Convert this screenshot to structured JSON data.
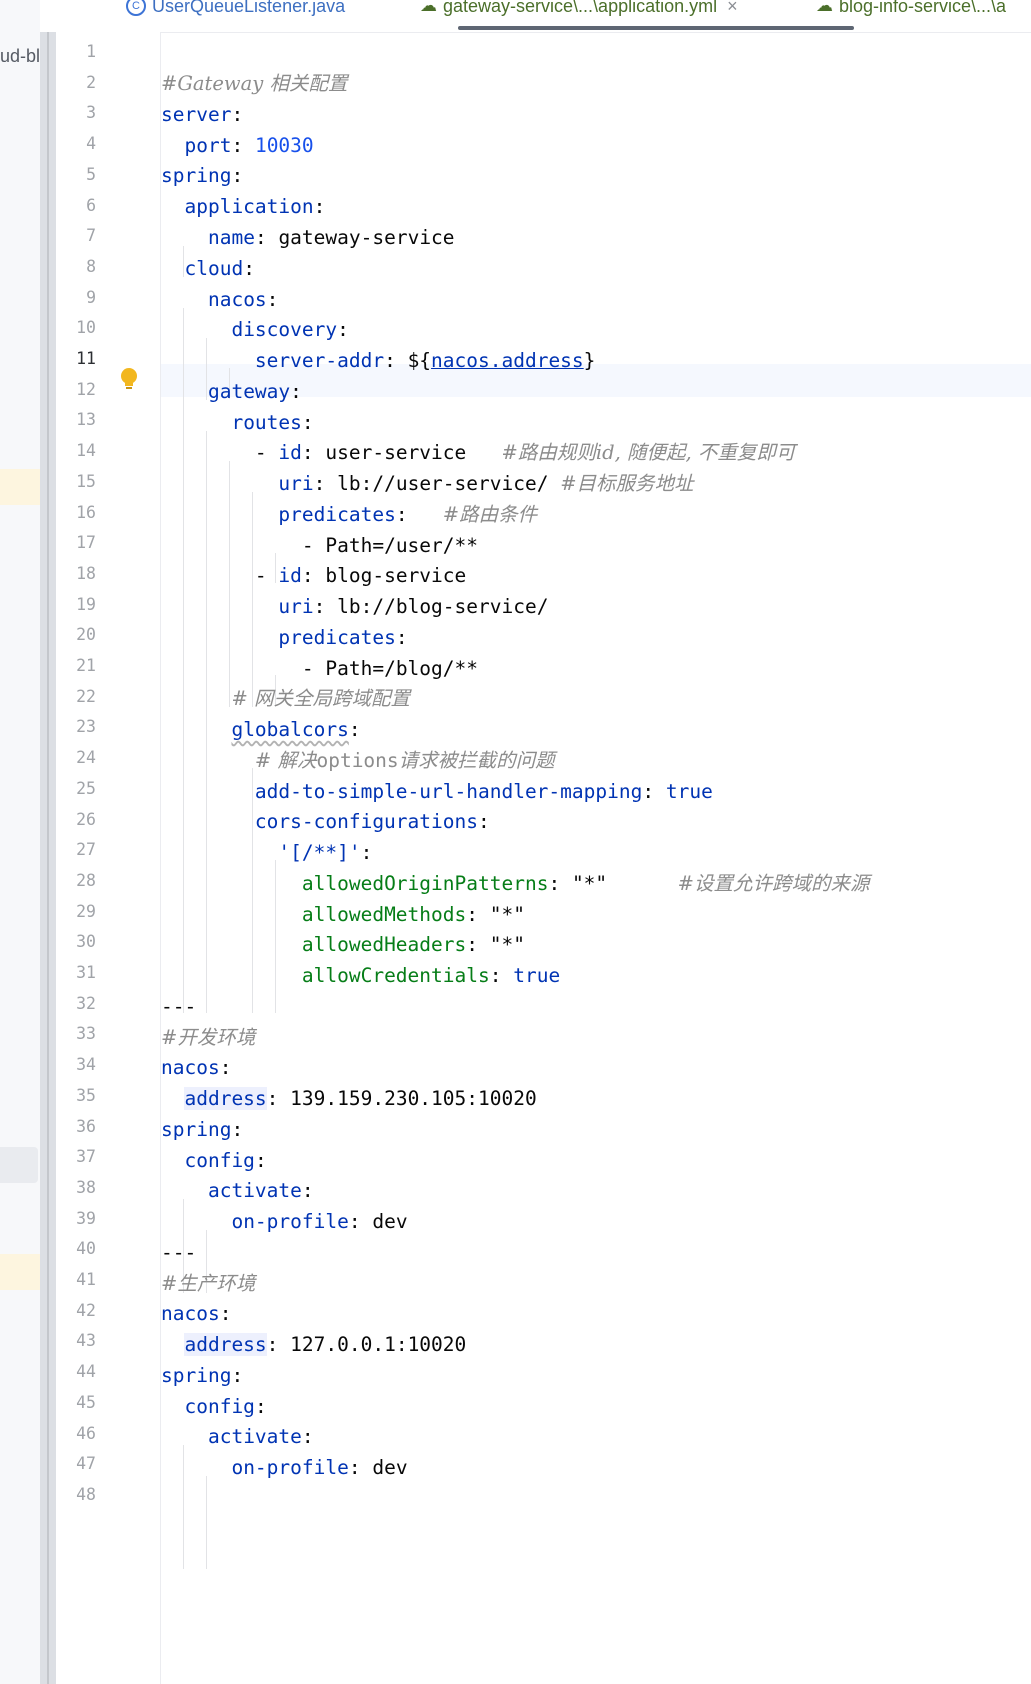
{
  "project": {
    "label": "ud-blo"
  },
  "tabs": [
    {
      "label": "UserQueueListener.java",
      "icon": "java-class-icon",
      "active": false
    },
    {
      "label": "gateway-service\\...\\application.yml",
      "icon": "yaml-file-icon",
      "active": true,
      "close": "×"
    },
    {
      "label": "blog-info-service\\...\\a",
      "icon": "yaml-file-icon",
      "active": false
    }
  ],
  "editor": {
    "current_line": 11,
    "line_numbers": [
      "1",
      "2",
      "3",
      "4",
      "5",
      "6",
      "7",
      "8",
      "9",
      "10",
      "11",
      "12",
      "13",
      "14",
      "15",
      "16",
      "17",
      "18",
      "19",
      "20",
      "21",
      "22",
      "23",
      "24",
      "25",
      "26",
      "27",
      "28",
      "29",
      "30",
      "31",
      "32",
      "33",
      "34",
      "35",
      "36",
      "37",
      "38",
      "39",
      "40",
      "41",
      "42",
      "43",
      "44",
      "45",
      "46",
      "47",
      "48"
    ],
    "code": {
      "l2": "#Gateway 相关配置",
      "l3_key": "server",
      "colon": ":",
      "l4_key": "port",
      "l4_val": "10030",
      "l5_key": "spring",
      "l6_key": "application",
      "l7_key": "name",
      "l7_val": "gateway-service",
      "l8_key": "cloud",
      "l9_key": "nacos",
      "l10_key": "discovery",
      "l11_key": "server-addr",
      "l11_pre": "${",
      "l11_ref": "nacos.address",
      "l11_post": "}",
      "l12_key": "gateway",
      "l13_key": "routes",
      "dash": "- ",
      "l14_key": "id",
      "l14_val": "user-service",
      "l14_cmt": "#路由规则id, 随便起, 不重复即可",
      "l15_key": "uri",
      "l15_val": "lb://user-service/",
      "l15_cmt": "#目标服务地址",
      "l16_key": "predicates",
      "l16_cmt": "#路由条件",
      "l17_val": "Path=/user/**",
      "l18_key": "id",
      "l18_val": "blog-service",
      "l19_key": "uri",
      "l19_val": "lb://blog-service/",
      "l20_key": "predicates",
      "l21_val": "Path=/blog/**",
      "l22_cmt": "# 网关全局跨域配置",
      "l23_key": "globalcors",
      "l24_cmt_a": "# 解决",
      "l24_cmt_b": "options",
      "l24_cmt_c": "请求被拦截的问题",
      "l25_key": "add-to-simple-url-handler-mapping",
      "l25_val": "true",
      "l26_key": "cors-configurations",
      "l27_key": "'[/**]'",
      "l28_key": "allowedOriginPatterns",
      "l28_val": "\"*\"",
      "l28_cmt": "#设置允许跨域的来源",
      "l29_key": "allowedMethods",
      "l29_val": "\"*\"",
      "l30_key": "allowedHeaders",
      "l30_val": "\"*\"",
      "l31_key": "allowCredentials",
      "l31_val": "true",
      "l32": "---",
      "l33_cmt": "#开发环境",
      "l34_key": "nacos",
      "l35_key": "address",
      "l35_val": "139.159.230.105:10020",
      "l36_key": "spring",
      "l37_key": "config",
      "l38_key": "activate",
      "l39_key": "on-profile",
      "l39_val": "dev",
      "l40": "---",
      "l41_cmt": "#生产环境",
      "l42_key": "nacos",
      "l43_key": "address",
      "l43_val": "127.0.0.1:10020",
      "l44_key": "spring",
      "l45_key": "config",
      "l46_key": "activate",
      "l47_key": "on-profile",
      "l47_val": "dev"
    }
  },
  "colors": {
    "key": "#0033b3",
    "comment": "#8c8c8c",
    "string": "#067d17",
    "number": "#1750eb",
    "current_line_bg": "#f5f8fe"
  }
}
